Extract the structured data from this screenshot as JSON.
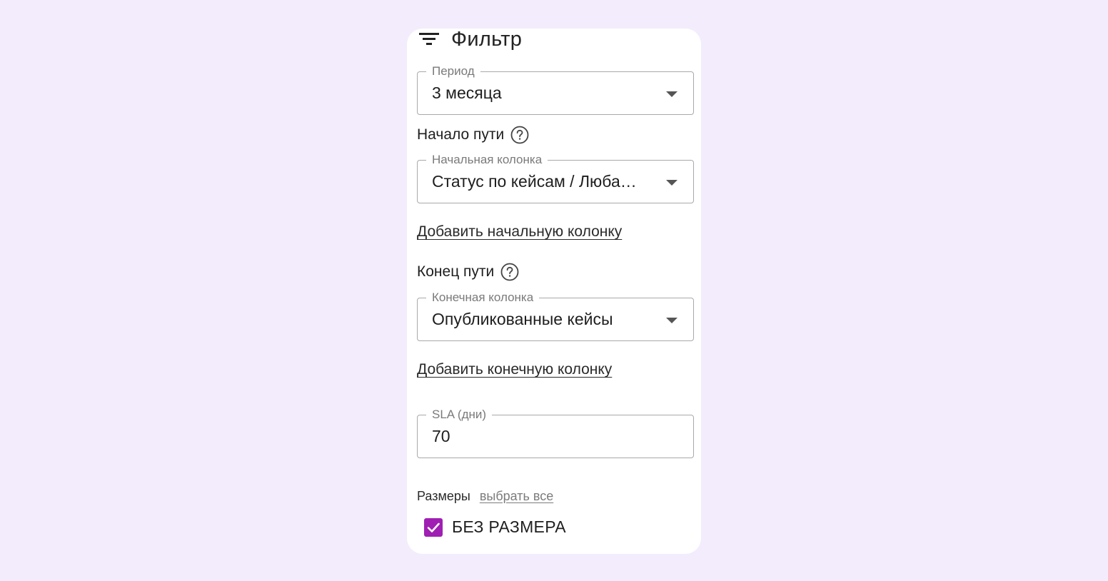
{
  "filter": {
    "title": "Фильтр",
    "icon": "filter-icon"
  },
  "period": {
    "label": "Период",
    "value": "3 месяца"
  },
  "path_start": {
    "heading": "Начало пути",
    "field_label": "Начальная колонка",
    "field_value": "Статус по кейсам / Люба…",
    "add_link": "Добавить начальную колонку"
  },
  "path_end": {
    "heading": "Конец пути",
    "field_label": "Конечная колонка",
    "field_value": "Опубликованные кейсы",
    "add_link": "Добавить конечную колонку"
  },
  "sla": {
    "label": "SLA (дни)",
    "value": "70"
  },
  "sizes": {
    "label": "Размеры",
    "select_all": "выбрать все",
    "options": [
      {
        "label": "БЕЗ РАЗМЕРА",
        "checked": true
      }
    ]
  },
  "colors": {
    "page_background": "#f3ecfc",
    "panel_background": "#ffffff",
    "checkbox_accent": "#a01fb3"
  }
}
